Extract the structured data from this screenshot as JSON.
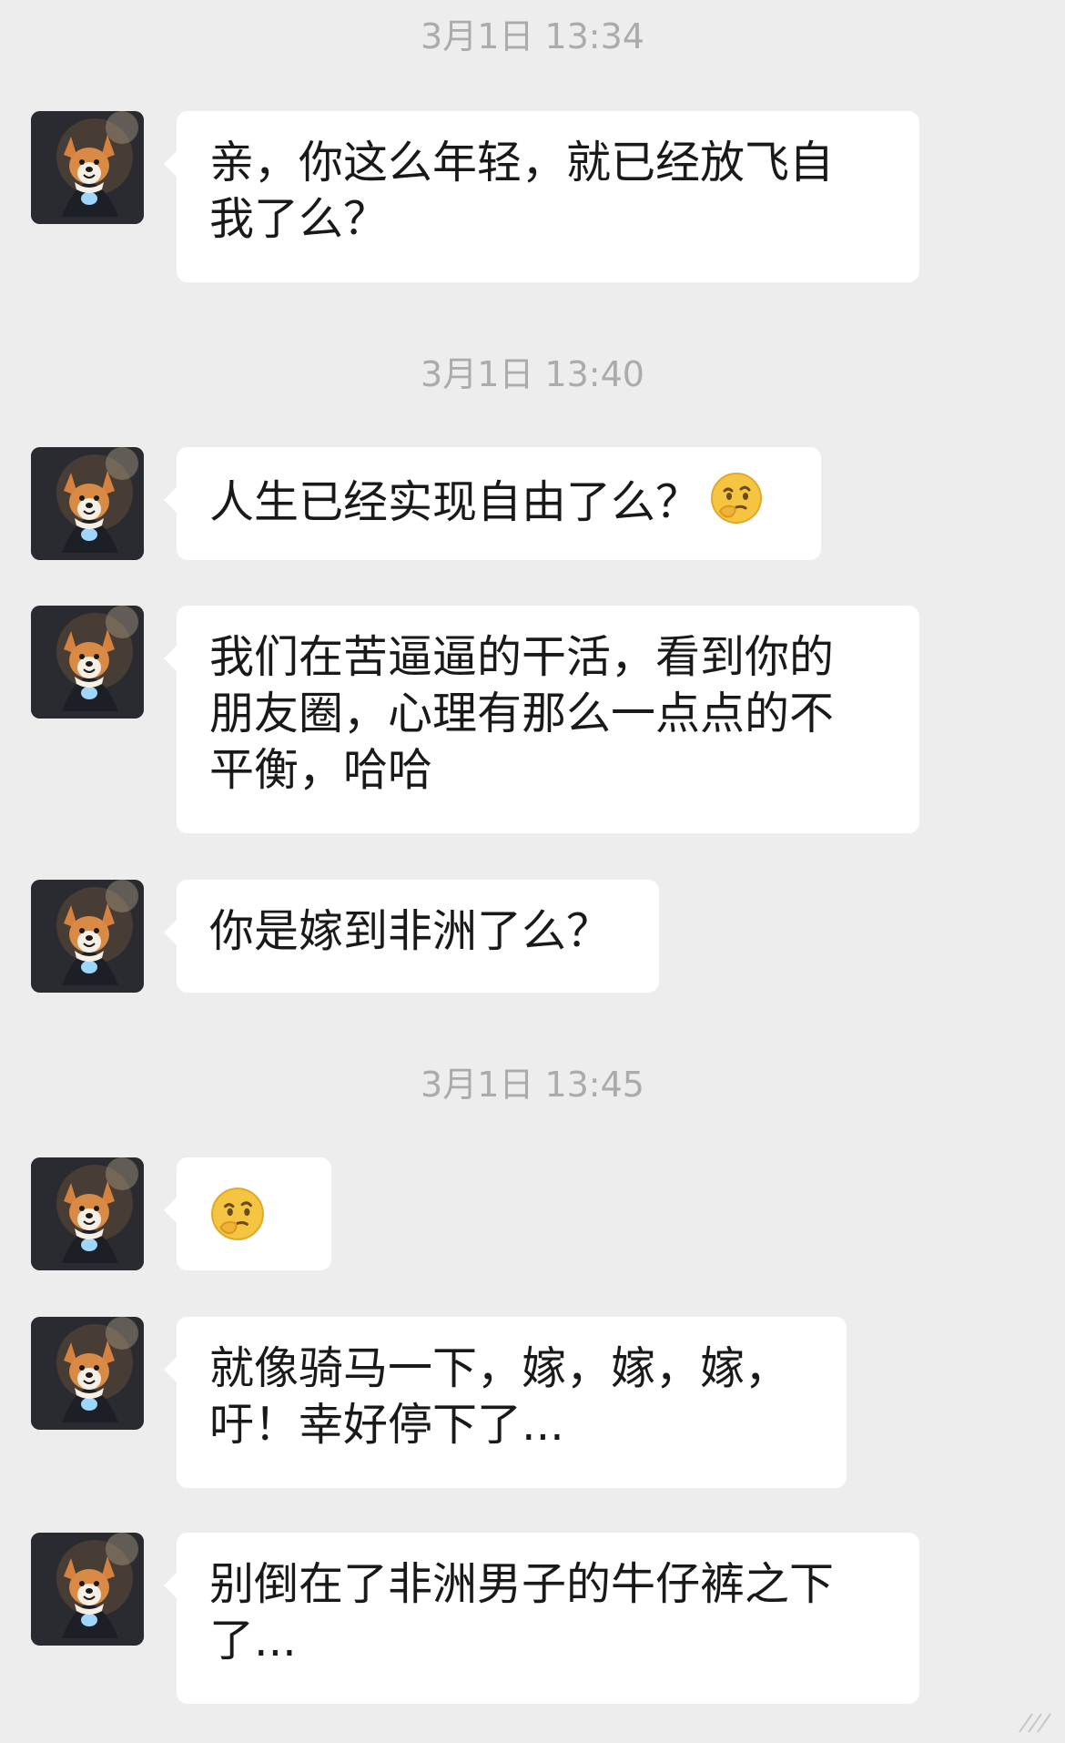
{
  "timestamps": [
    "3月1日 13:34",
    "3月1日 13:40",
    "3月1日 13:45"
  ],
  "messages": [
    {
      "text": "亲，你这么年轻，就已经放飞自\n我了么？",
      "emoji": ""
    },
    {
      "text": "人生已经实现自由了么？",
      "emoji": "thinking-face-icon"
    },
    {
      "text": "我们在苦逼逼的干活，看到你的\n朋友圈，心理有那么一点点的不\n平衡，哈哈",
      "emoji": ""
    },
    {
      "text": "你是嫁到非洲了么？",
      "emoji": ""
    },
    {
      "text": "",
      "emoji": "thinking-face-icon"
    },
    {
      "text": "就像骑马一下，嫁，嫁，嫁，\n吁！幸好停下了...",
      "emoji": ""
    },
    {
      "text": "别倒在了非洲男子的牛仔裤之下\n了...",
      "emoji": ""
    }
  ],
  "avatar": {
    "icon": "corgi-avatar-icon"
  },
  "colors": {
    "background": "#ededed",
    "bubble": "#ffffff",
    "timestamp": "#ababab",
    "text": "#191919"
  }
}
